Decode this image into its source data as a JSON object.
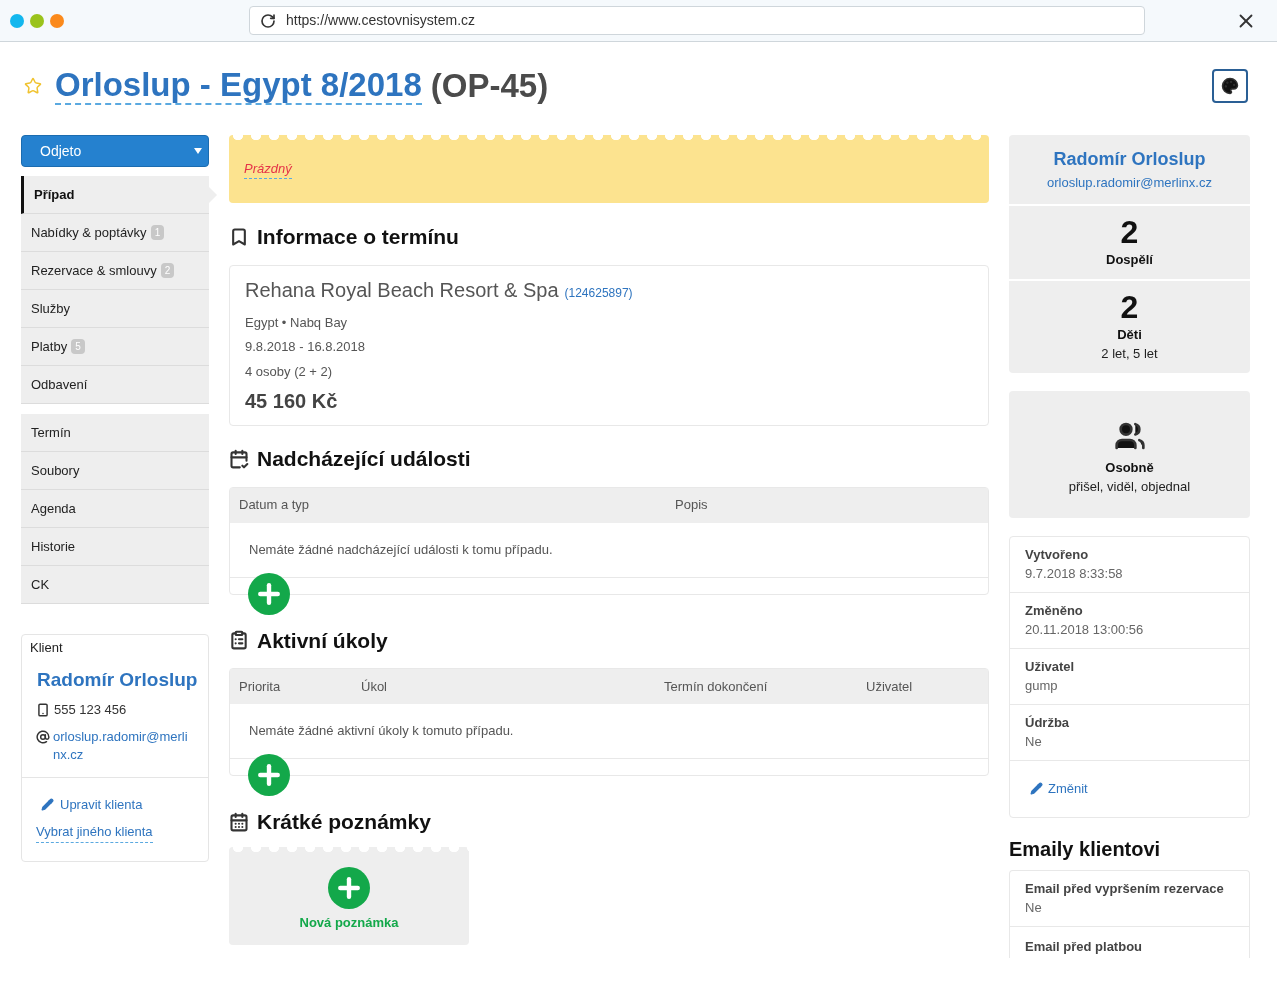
{
  "browser": {
    "url": "https://www.cestovnisystem.cz"
  },
  "page": {
    "title_link": "Orloslup - Egypt 8/2018",
    "title_code": "(OP-45)",
    "starred": false
  },
  "status_select": {
    "value": "Odjeto"
  },
  "nav_groups": [
    [
      {
        "label": "Případ",
        "selected": true
      },
      {
        "label": "Nabídky & poptávky",
        "badge": "1",
        "selected": false
      },
      {
        "label": "Rezervace & smlouvy",
        "badge": "2",
        "selected": false
      },
      {
        "label": "Služby",
        "selected": false
      },
      {
        "label": "Platby",
        "badge": "5",
        "selected": false
      },
      {
        "label": "Odbavení",
        "selected": false
      }
    ],
    [
      {
        "label": "Termín",
        "selected": false
      },
      {
        "label": "Soubory",
        "selected": false
      },
      {
        "label": "Agenda",
        "selected": false
      },
      {
        "label": "Historie",
        "selected": false
      },
      {
        "label": "CK",
        "selected": false
      }
    ]
  ],
  "client": {
    "heading": "Klient",
    "name": "Radomír Orloslup",
    "phone": "555 123 456",
    "email": "orloslup.radomir@merlinx.cz",
    "edit": "Upravit klienta",
    "choose": "Vybrat jiného klienta"
  },
  "note_banner": {
    "text": "Prázdný"
  },
  "info": {
    "heading": "Informace o termínu",
    "hotel": "Rehana Royal Beach Resort & Spa",
    "hotel_id": "(124625897)",
    "location": "Egypt • Nabq Bay",
    "dates": "9.8.2018 - 16.8.2018",
    "persons": "4 osoby (2 + 2)",
    "price": "45 160 Kč"
  },
  "events": {
    "heading": "Nadcházející události",
    "columns": [
      "Datum a typ",
      "Popis"
    ],
    "empty": "Nemáte žádné nadcházející události k tomu případu."
  },
  "tasks": {
    "heading": "Aktivní úkoly",
    "columns": [
      "Priorita",
      "Úkol",
      "Termín dokončení",
      "Uživatel"
    ],
    "empty": "Nemáte žádné aktivní úkoly k tomuto případu."
  },
  "notes": {
    "heading": "Krátké poznámky",
    "new_note": "Nová poznámka"
  },
  "summary": {
    "name": "Radomír Orloslup",
    "email": "orloslup.radomir@merlinx.cz",
    "stats": [
      {
        "count": "2",
        "label": "Dospělí"
      },
      {
        "count": "2",
        "label": "Děti",
        "sub": "2 let, 5 let"
      }
    ]
  },
  "contact": {
    "label": "Osobně",
    "sub": "přišel, viděl, objednal"
  },
  "meta": [
    {
      "label": "Vytvořeno",
      "value": "9.7.2018 8:33:58"
    },
    {
      "label": "Změněno",
      "value": "20.11.2018 13:00:56"
    },
    {
      "label": "Uživatel",
      "value": "gump"
    },
    {
      "label": "Údržba",
      "value": "Ne"
    }
  ],
  "meta_edit": "Změnit",
  "emails": {
    "heading": "Emaily klientovi",
    "items": [
      {
        "label": "Email před vypršením rezervace",
        "value": "Ne"
      },
      {
        "label": "Email před platbou"
      }
    ]
  }
}
